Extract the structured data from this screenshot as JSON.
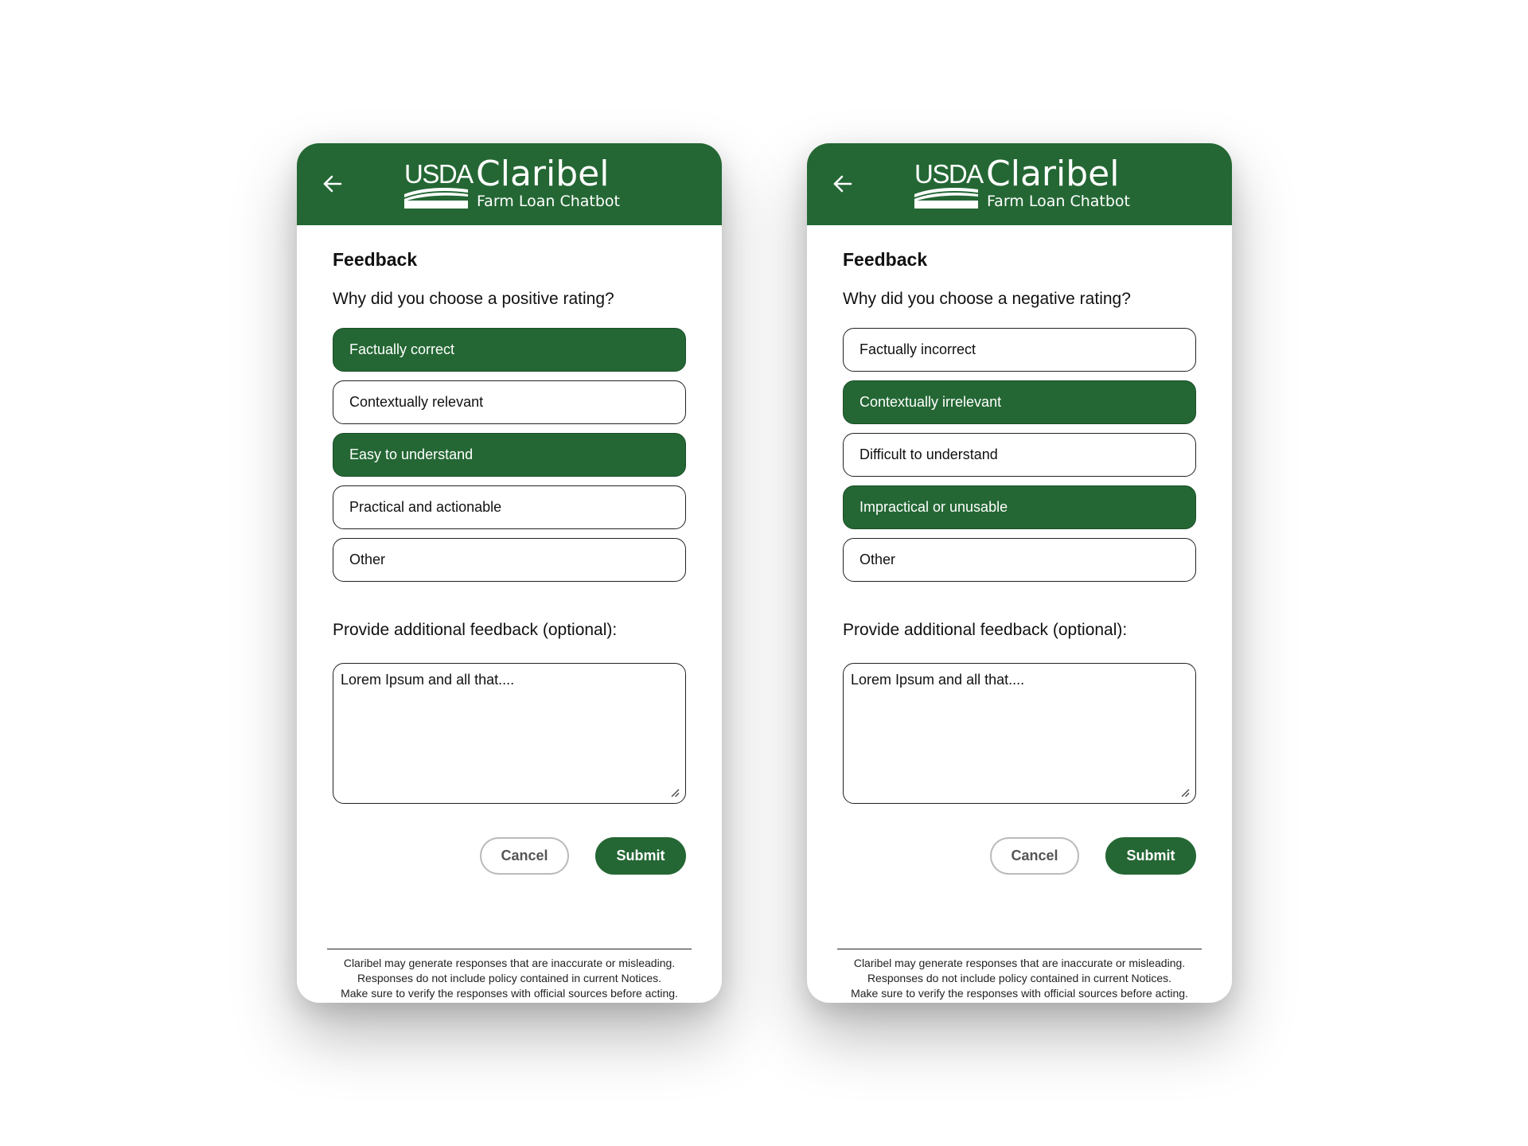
{
  "app": {
    "brand_usda": "USDA",
    "brand_title": "Claribel",
    "brand_subtitle": "Farm Loan Chatbot",
    "accent_color": "#246734"
  },
  "screens": [
    {
      "section_title": "Feedback",
      "question": "Why did you choose a positive rating?",
      "options": [
        {
          "label": "Factually correct",
          "selected": true
        },
        {
          "label": "Contextually relevant",
          "selected": false
        },
        {
          "label": "Easy to understand",
          "selected": true
        },
        {
          "label": "Practical and actionable",
          "selected": false
        },
        {
          "label": "Other",
          "selected": false
        }
      ],
      "feedback_label": "Provide additional feedback (optional):",
      "feedback_value": "Lorem Ipsum and all that....",
      "cancel_label": "Cancel",
      "submit_label": "Submit",
      "disclaimer": [
        "Claribel may generate responses that are inaccurate or misleading.",
        "Responses do not include policy contained in current Notices.",
        "Make sure to verify the responses with official sources before acting."
      ]
    },
    {
      "section_title": "Feedback",
      "question": "Why did you choose a negative rating?",
      "options": [
        {
          "label": "Factually incorrect",
          "selected": false
        },
        {
          "label": "Contextually irrelevant",
          "selected": true
        },
        {
          "label": "Difficult to understand",
          "selected": false
        },
        {
          "label": "Impractical or unusable",
          "selected": true
        },
        {
          "label": "Other",
          "selected": false
        }
      ],
      "feedback_label": "Provide additional feedback (optional):",
      "feedback_value": "Lorem Ipsum and all that....",
      "cancel_label": "Cancel",
      "submit_label": "Submit",
      "disclaimer": [
        "Claribel may generate responses that are inaccurate or misleading.",
        "Responses do not include policy contained in current Notices.",
        "Make sure to verify the responses with official sources before acting."
      ]
    }
  ]
}
